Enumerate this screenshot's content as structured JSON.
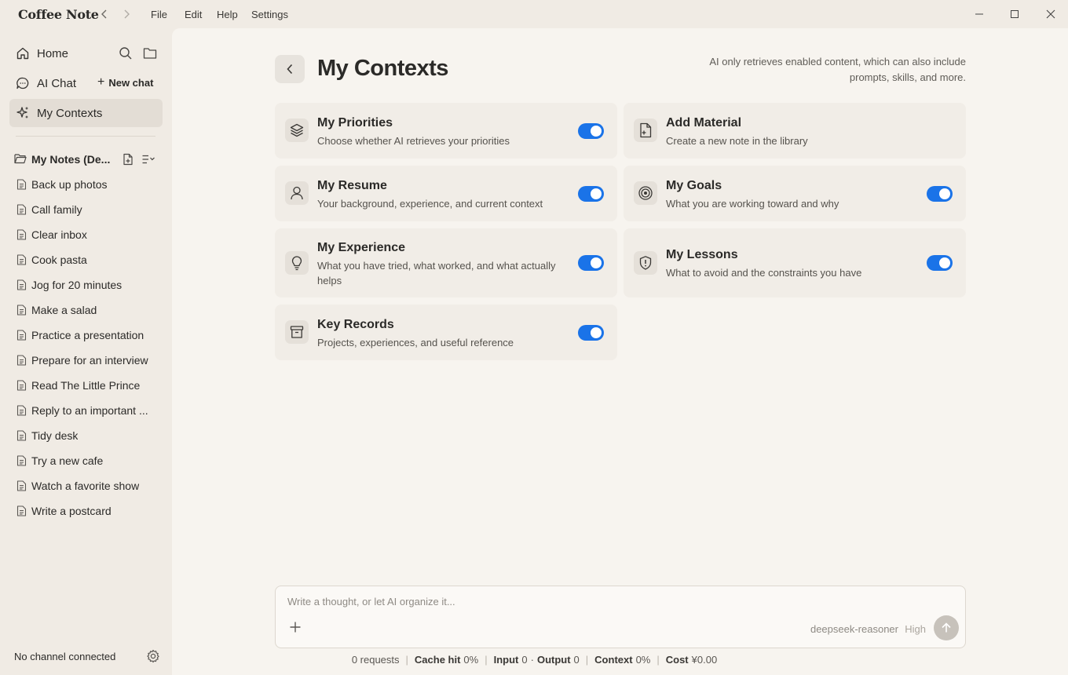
{
  "app": {
    "title": "Coffee Note"
  },
  "menu": {
    "file": "File",
    "edit": "Edit",
    "help": "Help",
    "settings": "Settings"
  },
  "sidebar": {
    "home": "Home",
    "ai_chat": "AI Chat",
    "new_chat": "New chat",
    "my_contexts": "My Contexts",
    "folder": "My Notes (De...",
    "notes": [
      "Back up photos",
      "Call family",
      "Clear inbox",
      "Cook pasta",
      "Jog for 20 minutes",
      "Make a salad",
      "Practice a presentation",
      "Prepare for an interview",
      "Read The Little Prince",
      "Reply to an important ...",
      "Tidy desk",
      "Try a new cafe",
      "Watch a favorite show",
      "Write a postcard"
    ],
    "status": "No channel connected"
  },
  "main": {
    "title": "My Contexts",
    "note": "AI only retrieves enabled content, which can also include prompts, skills, and more.",
    "cards": {
      "priorities": {
        "title": "My Priorities",
        "desc": "Choose whether AI retrieves your priorities",
        "icon": "layers-icon",
        "enabled": true
      },
      "add_material": {
        "title": "Add Material",
        "desc": "Create a new note in the library",
        "icon": "file-plus-icon"
      },
      "resume": {
        "title": "My Resume",
        "desc": "Your background, experience, and current context",
        "icon": "user-icon",
        "enabled": true
      },
      "goals": {
        "title": "My Goals",
        "desc": "What you are working toward and why",
        "icon": "target-icon",
        "enabled": true
      },
      "experience": {
        "title": "My Experience",
        "desc": "What you have tried, what worked, and what actually helps",
        "icon": "lightbulb-icon",
        "enabled": true
      },
      "lessons": {
        "title": "My Lessons",
        "desc": "What to avoid and the constraints you have",
        "icon": "shield-alert-icon",
        "enabled": true
      },
      "records": {
        "title": "Key Records",
        "desc": "Projects, experiences, and useful reference",
        "icon": "archive-icon",
        "enabled": true
      }
    }
  },
  "composer": {
    "placeholder": "Write a thought, or let AI organize it...",
    "model": "deepseek-reasoner",
    "level": "High"
  },
  "stats": {
    "requests": "0 requests",
    "cache_label": "Cache hit",
    "cache_value": "0%",
    "input_label": "Input",
    "input_value": "0",
    "output_label": "Output",
    "output_value": "0",
    "context_label": "Context",
    "context_value": "0%",
    "cost_label": "Cost",
    "cost_value": "¥0.00"
  },
  "colors": {
    "accent": "#1a73e8",
    "sidebar_bg": "#f0ebe4",
    "main_bg": "#f7f4ef",
    "card_bg": "#f1ede7"
  }
}
